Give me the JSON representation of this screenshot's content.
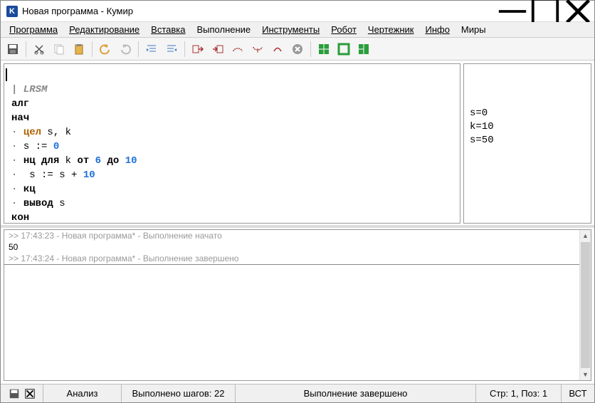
{
  "window": {
    "title": "Новая программа - Кумир",
    "app_letter": "K"
  },
  "menu": {
    "program": "Программа",
    "edit": "Редактирование",
    "insert": "Вставка",
    "run": "Выполнение",
    "tools": "Инструменты",
    "robot": "Робот",
    "drawer": "Чертежник",
    "info": "Инфо",
    "worlds": "Миры"
  },
  "code": {
    "comment": "| LRSM",
    "alg": "алг",
    "nach": "нач",
    "type_line_kw": "цел",
    "type_line_vars": " s, k",
    "assign1_lhs": "s := ",
    "assign1_num": "0",
    "loop_kw1": "нц для",
    "loop_var": " k ",
    "loop_kw2": "от",
    "loop_n1": " 6 ",
    "loop_kw3": "до",
    "loop_n2": " 10",
    "body_lhs": " s := s + ",
    "body_num": "10",
    "kc": "кц",
    "vyvod": "вывод",
    "vyvod_arg": " s",
    "kon": "кон"
  },
  "watch": {
    "l1": "s=0",
    "l2": "k=10",
    "l3": "s=50"
  },
  "output": {
    "l1": ">> 17:43:23 - Новая программа* - Выполнение начато",
    "l2": "50",
    "l3": ">> 17:43:24 - Новая программа* - Выполнение завершено"
  },
  "status": {
    "analysis": "Анализ",
    "steps": "Выполнено шагов: 22",
    "state": "Выполнение завершено",
    "pos": "Стр: 1, Поз: 1",
    "mode": "ВСТ"
  }
}
